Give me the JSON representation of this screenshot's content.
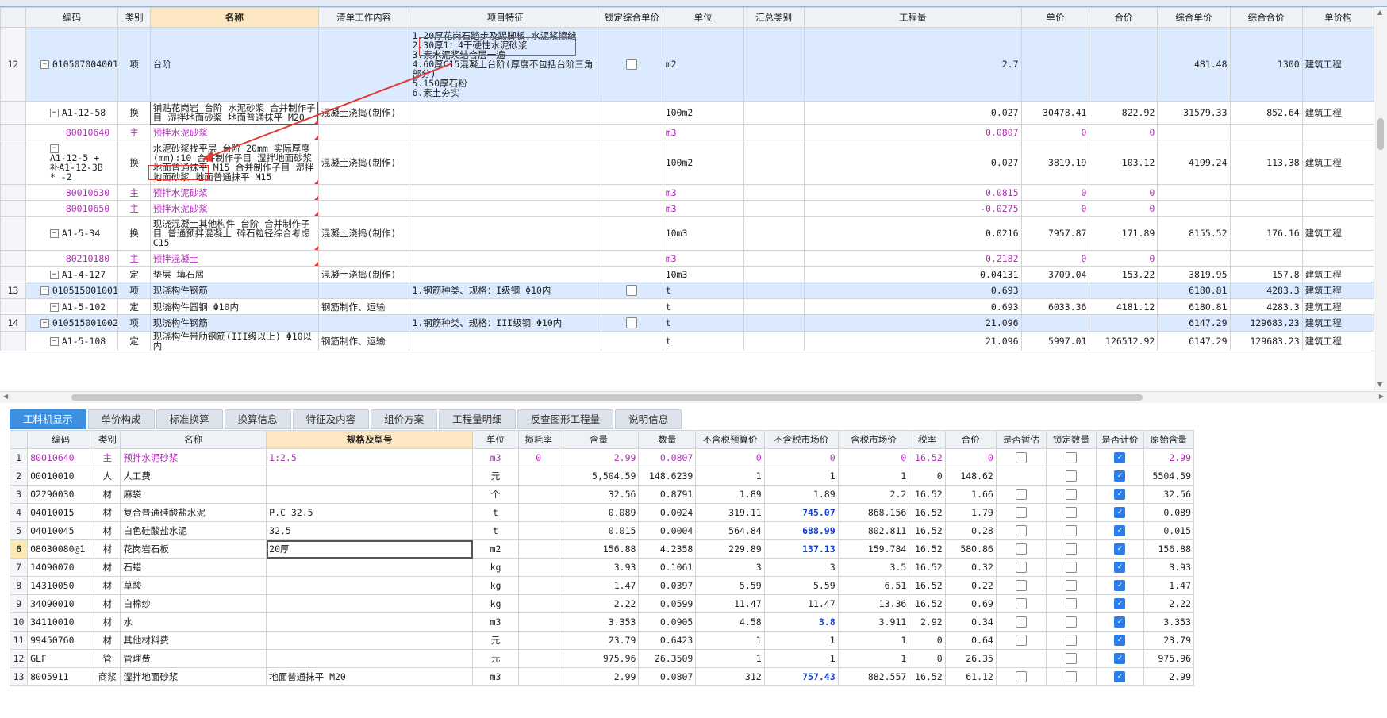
{
  "top_headers": [
    "编码",
    "类别",
    "名称",
    "清单工作内容",
    "项目特征",
    "锁定综合单价",
    "单位",
    "汇总类别",
    "工程量",
    "单价",
    "合价",
    "综合单价",
    "综合合价",
    "单价构"
  ],
  "top_rows": [
    {
      "num": "12",
      "code": "010507004001",
      "cat": "项",
      "name": "台阶",
      "work": "",
      "feature": [
        "1.20厚花岗石踏步及踢脚板,水泥浆擦缝",
        "2.30厚1：4干硬性水泥砂浆",
        "3.素水泥浆结合层一遍",
        "4.60厚C15混凝土台阶(厚度不包括台阶三角部分)",
        "5.150厚石粉",
        "6.素土夯实"
      ],
      "lock": true,
      "unit": "m2",
      "sum": "",
      "qty": "2.7",
      "price": "",
      "total": "",
      "comp_price": "481.48",
      "comp_total": "1300",
      "mark": "建筑工程",
      "style": "item"
    },
    {
      "num": "",
      "code": "A1-12-58",
      "cat": "换",
      "name": "铺贴花岗岩 台阶 水泥砂浆  合并制作子目 湿拌地面砂浆 地面普通抹平 M20",
      "work": "混凝土浇捣(制作)",
      "feature": [],
      "lock": false,
      "unit": "100m2",
      "sum": "",
      "qty": "0.027",
      "price": "30478.41",
      "total": "822.92",
      "comp_price": "31579.33",
      "comp_total": "852.64",
      "mark": "建筑工程",
      "style": "sub"
    },
    {
      "num": "",
      "code": "80010640",
      "cat": "主",
      "name": "预拌水泥砂浆",
      "work": "",
      "feature": [],
      "lock": false,
      "unit": "m3",
      "sum": "",
      "qty": "0.0807",
      "price": "0",
      "total": "0",
      "comp_price": "",
      "comp_total": "",
      "mark": "",
      "style": "mat"
    },
    {
      "num": "",
      "code": "A1-12-5 + 补A1-12-3B * -2",
      "cat": "换",
      "name": "水泥砂浆找平层 台阶 20mm  实际厚度(mm):10  合并制作子目 湿拌地面砂浆 地面普通抹平 M15  合并制作子目 湿拌地面砂浆 地面普通抹平 M15",
      "work": "混凝土浇捣(制作)",
      "feature": [],
      "lock": false,
      "unit": "100m2",
      "sum": "",
      "qty": "0.027",
      "price": "3819.19",
      "total": "103.12",
      "comp_price": "4199.24",
      "comp_total": "113.38",
      "mark": "建筑工程",
      "style": "sub"
    },
    {
      "num": "",
      "code": "80010630",
      "cat": "主",
      "name": "预拌水泥砂浆",
      "work": "",
      "feature": [],
      "lock": false,
      "unit": "m3",
      "sum": "",
      "qty": "0.0815",
      "price": "0",
      "total": "0",
      "comp_price": "",
      "comp_total": "",
      "mark": "",
      "style": "mat"
    },
    {
      "num": "",
      "code": "80010650",
      "cat": "主",
      "name": "预拌水泥砂浆",
      "work": "",
      "feature": [],
      "lock": false,
      "unit": "m3",
      "sum": "",
      "qty": "-0.0275",
      "price": "0",
      "total": "0",
      "comp_price": "",
      "comp_total": "",
      "mark": "",
      "style": "mat"
    },
    {
      "num": "",
      "code": "A1-5-34",
      "cat": "换",
      "name": "现浇混凝土其他构件 台阶  合并制作子目 普通预拌混凝土 碎石粒径综合考虑 C15",
      "work": "混凝土浇捣(制作)",
      "feature": [],
      "lock": false,
      "unit": "10m3",
      "sum": "",
      "qty": "0.0216",
      "price": "7957.87",
      "total": "171.89",
      "comp_price": "8155.52",
      "comp_total": "176.16",
      "mark": "建筑工程",
      "style": "sub"
    },
    {
      "num": "",
      "code": "80210180",
      "cat": "主",
      "name": "预拌混凝土",
      "work": "",
      "feature": [],
      "lock": false,
      "unit": "m3",
      "sum": "",
      "qty": "0.2182",
      "price": "0",
      "total": "0",
      "comp_price": "",
      "comp_total": "",
      "mark": "",
      "style": "mat"
    },
    {
      "num": "",
      "code": "A1-4-127",
      "cat": "定",
      "name": "垫层 填石屑",
      "work": "混凝土浇捣(制作)",
      "feature": [],
      "lock": false,
      "unit": "10m3",
      "sum": "",
      "qty": "0.04131",
      "price": "3709.04",
      "total": "153.22",
      "comp_price": "3819.95",
      "comp_total": "157.8",
      "mark": "建筑工程",
      "style": "sub"
    },
    {
      "num": "13",
      "code": "010515001001",
      "cat": "项",
      "name": "现浇构件钢筋",
      "work": "",
      "feature": [
        "1.钢筋种类、规格：I级钢 Φ10内"
      ],
      "lock": true,
      "unit": "t",
      "sum": "",
      "qty": "0.693",
      "price": "",
      "total": "",
      "comp_price": "6180.81",
      "comp_total": "4283.3",
      "mark": "建筑工程",
      "style": "item"
    },
    {
      "num": "",
      "code": "A1-5-102",
      "cat": "定",
      "name": "现浇构件圆钢 Φ10内",
      "work": "钢筋制作、运输",
      "feature": [],
      "lock": false,
      "unit": "t",
      "sum": "",
      "qty": "0.693",
      "price": "6033.36",
      "total": "4181.12",
      "comp_price": "6180.81",
      "comp_total": "4283.3",
      "mark": "建筑工程",
      "style": "sub"
    },
    {
      "num": "14",
      "code": "010515001002",
      "cat": "项",
      "name": "现浇构件钢筋",
      "work": "",
      "feature": [
        "1.钢筋种类、规格：III级钢 Φ10内"
      ],
      "lock": true,
      "unit": "t",
      "sum": "",
      "qty": "21.096",
      "price": "",
      "total": "",
      "comp_price": "6147.29",
      "comp_total": "129683.23",
      "mark": "建筑工程",
      "style": "item"
    },
    {
      "num": "",
      "code": "A1-5-108",
      "cat": "定",
      "name": "现浇构件带肋钢筋(III级以上) Φ10以内",
      "work": "钢筋制作、运输",
      "feature": [],
      "lock": false,
      "unit": "t",
      "sum": "",
      "qty": "21.096",
      "price": "5997.01",
      "total": "126512.92",
      "comp_price": "6147.29",
      "comp_total": "129683.23",
      "mark": "建筑工程",
      "style": "sub"
    }
  ],
  "bottom_tabs": [
    "工料机显示",
    "单价构成",
    "标准换算",
    "换算信息",
    "特征及内容",
    "组价方案",
    "工程量明细",
    "反查图形工程量",
    "说明信息"
  ],
  "bottom_headers": [
    "编码",
    "类别",
    "名称",
    "规格及型号",
    "单位",
    "损耗率",
    "含量",
    "数量",
    "不含税预算价",
    "不含税市场价",
    "含税市场价",
    "税率",
    "合价",
    "是否暂估",
    "锁定数量",
    "是否计价",
    "原始含量"
  ],
  "bottom_rows": [
    {
      "num": "1",
      "code": "80010640",
      "cat": "主",
      "name": "预拌水泥砂浆",
      "spec": "1:2.5",
      "unit": "m3",
      "loss": "0",
      "content": "2.99",
      "qty": "0.0807",
      "budget": "0",
      "market": "0",
      "tax_market": "0",
      "rate": "16.52",
      "total": "0",
      "est": false,
      "lockq": false,
      "priced": true,
      "orig": "2.99",
      "mag": true,
      "bold": false
    },
    {
      "num": "2",
      "code": "00010010",
      "cat": "人",
      "name": "人工费",
      "spec": "",
      "unit": "元",
      "loss": "",
      "content": "5,504.59",
      "qty": "148.6239",
      "budget": "1",
      "market": "1",
      "tax_market": "1",
      "rate": "0",
      "total": "148.62",
      "est": null,
      "lockq": false,
      "priced": true,
      "orig": "5504.59",
      "mag": false,
      "bold": false
    },
    {
      "num": "3",
      "code": "02290030",
      "cat": "材",
      "name": "麻袋",
      "spec": "",
      "unit": "个",
      "loss": "",
      "content": "32.56",
      "qty": "0.8791",
      "budget": "1.89",
      "market": "1.89",
      "tax_market": "2.2",
      "rate": "16.52",
      "total": "1.66",
      "est": false,
      "lockq": false,
      "priced": true,
      "orig": "32.56",
      "mag": false,
      "bold": false
    },
    {
      "num": "4",
      "code": "04010015",
      "cat": "材",
      "name": "复合普通硅酸盐水泥",
      "spec": "P.C 32.5",
      "unit": "t",
      "loss": "",
      "content": "0.089",
      "qty": "0.0024",
      "budget": "319.11",
      "market": "745.07",
      "tax_market": "868.156",
      "rate": "16.52",
      "total": "1.79",
      "est": false,
      "lockq": false,
      "priced": true,
      "orig": "0.089",
      "mag": false,
      "bold": true
    },
    {
      "num": "5",
      "code": "04010045",
      "cat": "材",
      "name": "白色硅酸盐水泥",
      "spec": "32.5",
      "unit": "t",
      "loss": "",
      "content": "0.015",
      "qty": "0.0004",
      "budget": "564.84",
      "market": "688.99",
      "tax_market": "802.811",
      "rate": "16.52",
      "total": "0.28",
      "est": false,
      "lockq": false,
      "priced": true,
      "orig": "0.015",
      "mag": false,
      "bold": true
    },
    {
      "num": "6",
      "code": "08030080@1",
      "cat": "材",
      "name": "花岗岩石板",
      "spec": "20厚",
      "unit": "m2",
      "loss": "",
      "content": "156.88",
      "qty": "4.2358",
      "budget": "229.89",
      "market": "137.13",
      "tax_market": "159.784",
      "rate": "16.52",
      "total": "580.86",
      "est": false,
      "lockq": false,
      "priced": true,
      "orig": "156.88",
      "mag": false,
      "bold": true
    },
    {
      "num": "7",
      "code": "14090070",
      "cat": "材",
      "name": "石蜡",
      "spec": "",
      "unit": "kg",
      "loss": "",
      "content": "3.93",
      "qty": "0.1061",
      "budget": "3",
      "market": "3",
      "tax_market": "3.5",
      "rate": "16.52",
      "total": "0.32",
      "est": false,
      "lockq": false,
      "priced": true,
      "orig": "3.93",
      "mag": false,
      "bold": false
    },
    {
      "num": "8",
      "code": "14310050",
      "cat": "材",
      "name": "草酸",
      "spec": "",
      "unit": "kg",
      "loss": "",
      "content": "1.47",
      "qty": "0.0397",
      "budget": "5.59",
      "market": "5.59",
      "tax_market": "6.51",
      "rate": "16.52",
      "total": "0.22",
      "est": false,
      "lockq": false,
      "priced": true,
      "orig": "1.47",
      "mag": false,
      "bold": false
    },
    {
      "num": "9",
      "code": "34090010",
      "cat": "材",
      "name": "白棉纱",
      "spec": "",
      "unit": "kg",
      "loss": "",
      "content": "2.22",
      "qty": "0.0599",
      "budget": "11.47",
      "market": "11.47",
      "tax_market": "13.36",
      "rate": "16.52",
      "total": "0.69",
      "est": false,
      "lockq": false,
      "priced": true,
      "orig": "2.22",
      "mag": false,
      "bold": false
    },
    {
      "num": "10",
      "code": "34110010",
      "cat": "材",
      "name": "水",
      "spec": "",
      "unit": "m3",
      "loss": "",
      "content": "3.353",
      "qty": "0.0905",
      "budget": "4.58",
      "market": "3.8",
      "tax_market": "3.911",
      "rate": "2.92",
      "total": "0.34",
      "est": false,
      "lockq": false,
      "priced": true,
      "orig": "3.353",
      "mag": false,
      "bold": true
    },
    {
      "num": "11",
      "code": "99450760",
      "cat": "材",
      "name": "其他材料费",
      "spec": "",
      "unit": "元",
      "loss": "",
      "content": "23.79",
      "qty": "0.6423",
      "budget": "1",
      "market": "1",
      "tax_market": "1",
      "rate": "0",
      "total": "0.64",
      "est": false,
      "lockq": false,
      "priced": true,
      "orig": "23.79",
      "mag": false,
      "bold": false
    },
    {
      "num": "12",
      "code": "GLF",
      "cat": "管",
      "name": "管理费",
      "spec": "",
      "unit": "元",
      "loss": "",
      "content": "975.96",
      "qty": "26.3509",
      "budget": "1",
      "market": "1",
      "tax_market": "1",
      "rate": "0",
      "total": "26.35",
      "est": null,
      "lockq": false,
      "priced": true,
      "orig": "975.96",
      "mag": false,
      "bold": false
    },
    {
      "num": "13",
      "code": "8005911",
      "cat": "商浆",
      "name": "湿拌地面砂浆",
      "spec": "地面普通抹平 M20",
      "unit": "m3",
      "loss": "",
      "content": "2.99",
      "qty": "0.0807",
      "budget": "312",
      "market": "757.43",
      "tax_market": "882.557",
      "rate": "16.52",
      "total": "61.12",
      "est": false,
      "lockq": false,
      "priced": true,
      "orig": "2.99",
      "mag": false,
      "bold": true
    }
  ],
  "colors": {
    "accent": "#3d8fe0",
    "item_row": "#dbeafe",
    "material_text": "#b12fb8",
    "market_price_bold": "#1440d0",
    "annotation": "#e53935"
  },
  "icons": [
    "tree-collapse-icon",
    "checkbox-icon",
    "checkbox-checked-icon",
    "scroll-arrow-icon"
  ]
}
